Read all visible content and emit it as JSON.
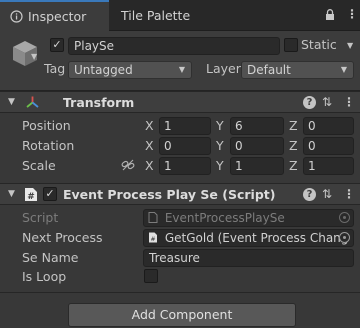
{
  "tabs": [
    {
      "label": "Inspector",
      "icon": "info-icon",
      "active": true
    },
    {
      "label": "Tile Palette",
      "active": false
    }
  ],
  "toolbar_icons": [
    "lock-icon",
    "more-icon"
  ],
  "gameobject": {
    "icon": "cube-icon",
    "active": true,
    "name": "PlaySe",
    "static_label": "Static",
    "static": false,
    "tag_label": "Tag",
    "tag_value": "Untagged",
    "layer_label": "Layer",
    "layer_value": "Default"
  },
  "transform": {
    "title": "Transform",
    "rows": [
      {
        "label": "Position",
        "x": "1",
        "y": "6",
        "z": "0"
      },
      {
        "label": "Rotation",
        "x": "0",
        "y": "0",
        "z": "0"
      },
      {
        "label": "Scale",
        "x": "1",
        "y": "1",
        "z": "1"
      }
    ],
    "axes": [
      "X",
      "Y",
      "Z"
    ]
  },
  "script_component": {
    "title": "Event Process Play Se (Script)",
    "enabled": true,
    "fields": {
      "script_label": "Script",
      "script_value": "EventProcessPlaySe",
      "next_label": "Next Process",
      "next_value": "GetGold (Event Process Chang",
      "sename_label": "Se Name",
      "sename_value": "Treasure",
      "isloop_label": "Is Loop",
      "isloop_value": false
    }
  },
  "add_component_label": "Add Component",
  "colors": {
    "background": "#383838",
    "tab_accent": "#3a79bb",
    "transform_icon_red": "#d9534f",
    "transform_icon_green": "#6cbf4a",
    "transform_icon_blue": "#4a8fd9"
  }
}
